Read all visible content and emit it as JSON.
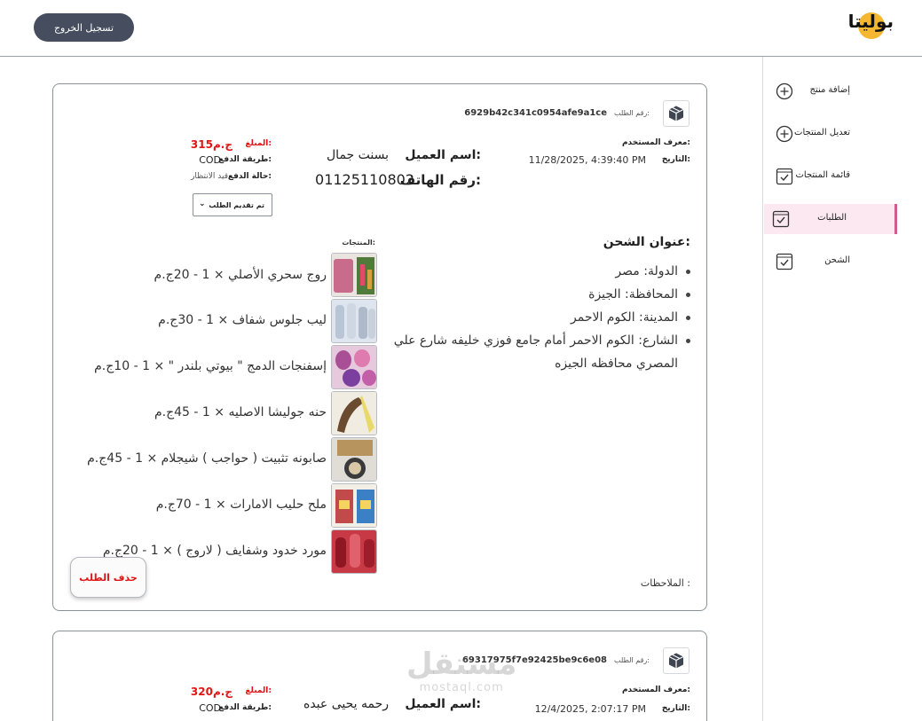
{
  "header": {
    "logout_label": "تسجيل الخروج",
    "logo_text": "بوليتا"
  },
  "sidebar": {
    "items": [
      {
        "label": "إضافة منتج",
        "icon": "plus-circle-icon"
      },
      {
        "label": "تعديل المنتجات",
        "icon": "plus-circle-icon"
      },
      {
        "label": "قائمة المنتجات",
        "icon": "checkbox-icon"
      },
      {
        "label": "الطلبات",
        "icon": "checkbox-icon",
        "active": true
      },
      {
        "label": "الشحن",
        "icon": "checkbox-icon"
      }
    ]
  },
  "labels": {
    "order_id": "رقم الطلب:",
    "user_id": "معرف المستخدم:",
    "date": "التاريخ:",
    "customer_name": "اسم العميل:",
    "phone": "رقم الهاتف:",
    "amount": "المبلغ:",
    "payment_method": "طريقة الدفع:",
    "payment_status": "حالة الدفع:",
    "shipping_address": "عنوان الشحن:",
    "products": "المنتجات:",
    "notes": "الملاحظات :",
    "delete": "حذف الطلب",
    "country": "الدولة:",
    "governorate": "المحافظة:",
    "city": "المدينة:",
    "street": "الشارع:"
  },
  "orders": [
    {
      "id": "6929b42c341c0954afe9a1ce",
      "date": "11/28/2025, 4:39:40 PM",
      "customer": "بسنت جمال",
      "phone": "01125110802",
      "amount": "315ج.م",
      "payment_method": "COD",
      "payment_status": "قيد الانتظار",
      "order_status": "تم تقديم الطلب",
      "address": {
        "country": "مصر",
        "governorate": "الجيزة",
        "city": "الكوم الاحمر",
        "street": "الكوم الاحمر أمام جامع فوزي خليفه شارع علي المصري محافظه الجيزه"
      },
      "products": [
        {
          "line": "روج سحري الأصلي × 1 - 20ج.م",
          "thumb_color": "#4f7a3a"
        },
        {
          "line": "ليب جلوس شفاف × 1 - 30ج.م",
          "thumb_color": "#b9c4d4"
        },
        {
          "line": "إسفنجات الدمج \" بيوتي بلندر \" × 1 - 10ج.م",
          "thumb_color": "#a84f96"
        },
        {
          "line": "حنه جوليشا الاصليه × 1 - 45ج.م",
          "thumb_color": "#6b4b2f"
        },
        {
          "line": "صابونه تثبيت ( حواجب ) شيجلام × 1 - 45ج.م",
          "thumb_color": "#b7935e"
        },
        {
          "line": "ملح حليب الامارات × 1 - 70ج.م",
          "thumb_color": "#c14a4a"
        },
        {
          "line": "مورد خدود وشفايف ( لاروج ) × 1 - 20ج.م",
          "thumb_color": "#b21d2d"
        }
      ]
    },
    {
      "id": "69317975f7e92425be9c6e08",
      "date": "12/4/2025, 2:07:17 PM",
      "customer": "رحمه يحيى عبده",
      "amount": "320ج.م",
      "payment_method": "COD"
    }
  ],
  "watermark": {
    "line1": "مستقل",
    "line2": "mostaql.com"
  },
  "colors": {
    "accent_red": "#e01515",
    "active_bg": "#fce8f0",
    "active_bar": "#d15b8e",
    "button_dark": "#454d5e"
  }
}
